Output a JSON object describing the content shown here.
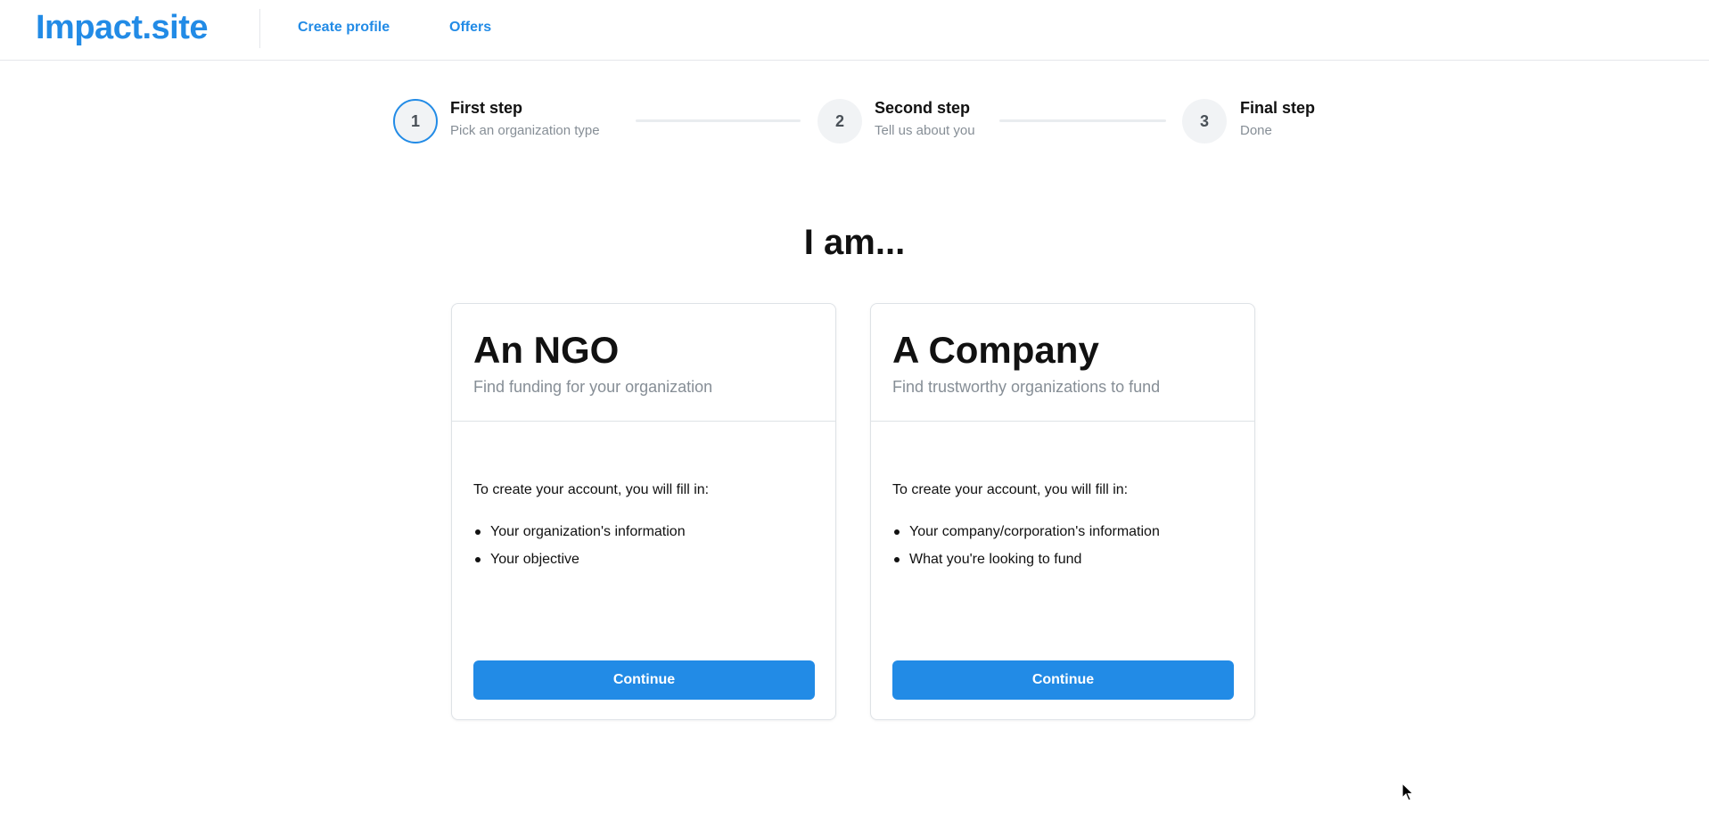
{
  "header": {
    "logo": "Impact.site",
    "nav": [
      {
        "label": "Create profile"
      },
      {
        "label": "Offers"
      }
    ]
  },
  "stepper": {
    "active_step": 1,
    "steps": [
      {
        "number": "1",
        "title": "First step",
        "description": "Pick an organization type"
      },
      {
        "number": "2",
        "title": "Second step",
        "description": "Tell us about you"
      },
      {
        "number": "3",
        "title": "Final step",
        "description": "Done"
      }
    ]
  },
  "main": {
    "heading": "I am...",
    "cards": [
      {
        "title": "An NGO",
        "subtitle": "Find funding for your organization",
        "intro": "To create your account, you will fill in:",
        "items": [
          "Your organization's information",
          "Your objective"
        ],
        "button": "Continue"
      },
      {
        "title": "A Company",
        "subtitle": "Find trustworthy organizations to fund",
        "intro": "To create your account, you will fill in:",
        "items": [
          "Your company/corporation's information",
          "What you're looking to fund"
        ],
        "button": "Continue"
      }
    ]
  },
  "colors": {
    "accent": "#228be6",
    "muted_text": "#868e96",
    "border": "#dee2e6"
  }
}
